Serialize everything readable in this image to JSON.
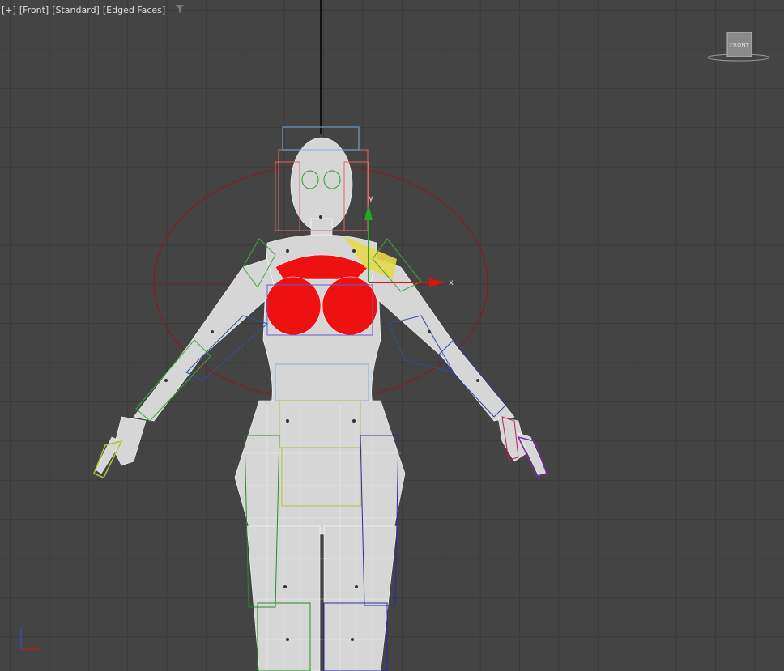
{
  "viewport": {
    "labels": [
      "[+]",
      "[Front]",
      "[Standard]",
      "[Edged Faces]"
    ],
    "filter_icon": "filter-icon"
  },
  "viewcube": {
    "face_label": "FRONT"
  },
  "gizmo": {
    "x_label": "x",
    "y_label": "y"
  },
  "colors": {
    "background": "#444444",
    "grid": "#3a3a3a",
    "mesh": "#d8d8d8",
    "bone_red": "#ee1111",
    "gizmo_x": "#dd1111",
    "gizmo_y": "#22aa22",
    "selection_circle": "#8b1a1a",
    "yellow_highlight": "#e8d84a"
  }
}
